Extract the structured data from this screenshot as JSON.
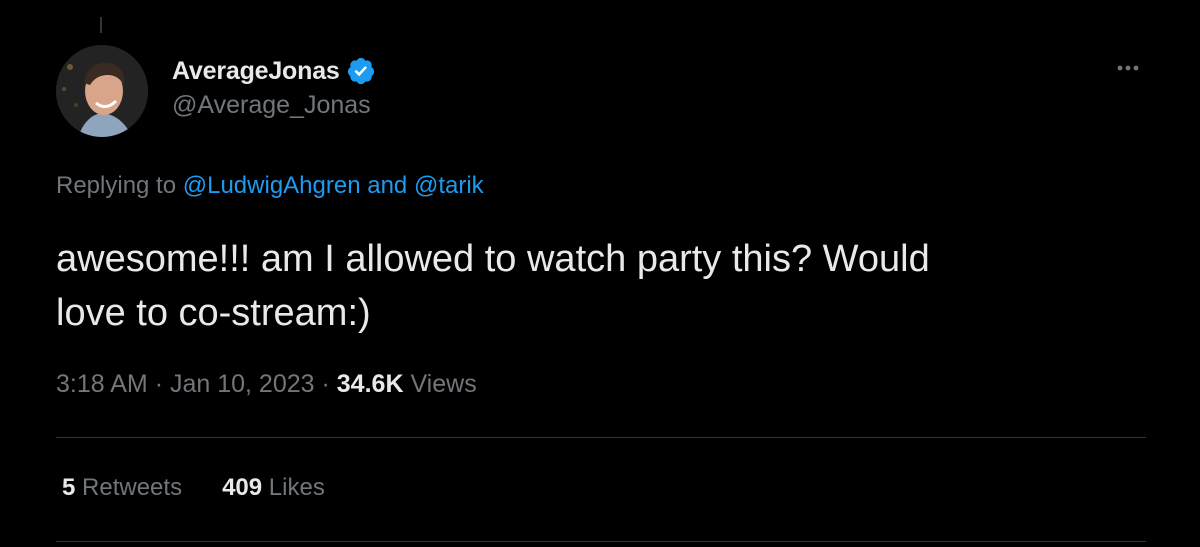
{
  "author": {
    "display_name": "AverageJonas",
    "handle": "@Average_Jonas",
    "verified": true
  },
  "reply_context": {
    "prefix": "Replying to",
    "mention_1": "@LudwigAhgren",
    "and": "and",
    "mention_2": "@tarik"
  },
  "tweet": {
    "line_1": "awesome!!! am I allowed to watch party this? Would",
    "line_2": "love to co-stream:)"
  },
  "meta": {
    "time": "3:18 AM",
    "sep_1": "·",
    "date": "Jan 10, 2023",
    "sep_2": "·",
    "views_count": "34.6K",
    "views_label": "Views"
  },
  "stats": {
    "retweets_count": "5",
    "retweets_label": "Retweets",
    "likes_count": "409",
    "likes_label": "Likes"
  },
  "icons": {
    "verified": "verified-badge-icon",
    "more": "more-horizontal-icon"
  },
  "colors": {
    "background": "#000000",
    "text_primary": "#e7e9ea",
    "text_secondary": "#71767b",
    "link": "#1d9bf0",
    "divider": "#2f3336"
  }
}
